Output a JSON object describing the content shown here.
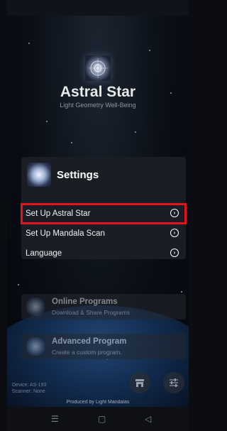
{
  "app": {
    "title": "Astral Star",
    "subtitle": "Light Geometry Well-Being"
  },
  "settings": {
    "title": "Settings",
    "items": [
      {
        "label": "Set Up Astral Star",
        "highlighted": true
      },
      {
        "label": "Set Up Mandala Scan",
        "highlighted": false
      },
      {
        "label": "Language",
        "highlighted": false
      }
    ]
  },
  "programs": [
    {
      "title": "Online Programs",
      "subtitle": "Download & Share Programs"
    },
    {
      "title": "Advanced Program",
      "subtitle": "Create a custom program."
    }
  ],
  "device": {
    "device_line": "Device: AS-193",
    "scanner_line": "Scanner: None"
  },
  "footer": "Produced by Light Mandalas",
  "icons": {
    "store": "store-icon",
    "sliders": "sliders-icon",
    "arrow": "arrow-right-circle-icon"
  },
  "colors": {
    "highlight": "#e3141b",
    "card": "#1a1d23"
  }
}
